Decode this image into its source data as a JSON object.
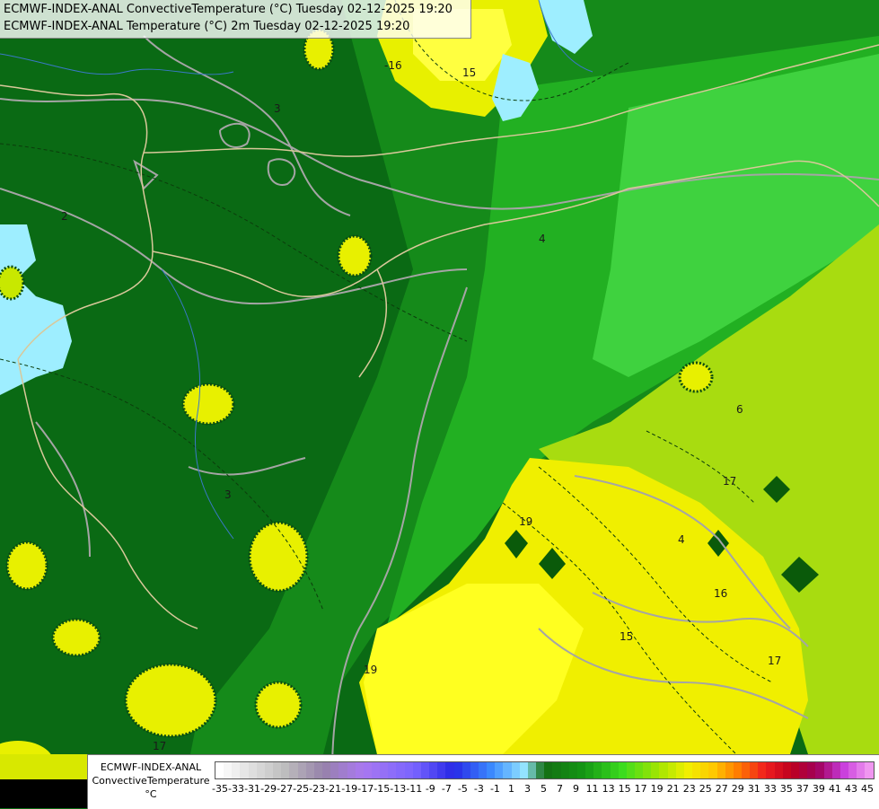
{
  "header": {
    "line1": "ECMWF-INDEX-ANAL ConvectiveTemperature (°C) Tuesday 02-12-2025 19:20",
    "line2": "ECMWF-INDEX-ANAL Temperature (°C) 2m Tuesday 02-12-2025 19:20"
  },
  "legend": {
    "model": "ECMWF-INDEX-ANAL",
    "parameter": "ConvectiveTemperature",
    "unit": "°C",
    "ticks": [
      "-35",
      "-33",
      "-31",
      "-29",
      "-27",
      "-25",
      "-23",
      "-21",
      "-19",
      "-17",
      "-15",
      "-13",
      "-11",
      "-9",
      "-7",
      "-5",
      "-3",
      "-1",
      "1",
      "3",
      "5",
      "7",
      "9",
      "11",
      "13",
      "15",
      "17",
      "19",
      "21",
      "23",
      "25",
      "27",
      "29",
      "31",
      "33",
      "35",
      "37",
      "39",
      "41",
      "43",
      "45"
    ]
  },
  "map_labels": [
    "-16",
    "15",
    "2",
    "3",
    "3",
    "4",
    "19",
    "17",
    "16",
    "15",
    "17",
    "19",
    "6",
    "4",
    "17"
  ],
  "colors": {
    "deep_green": "#0a6a14",
    "green": "#1f8f1f",
    "bright_green": "#2cc42c",
    "lime": "#9ad800",
    "yellow": "#f2f200",
    "light_yellow": "#ffff30",
    "cyan": "#a0f0ff",
    "contour_grey": "#a0a0a0",
    "border_beige": "#d9c89a"
  }
}
